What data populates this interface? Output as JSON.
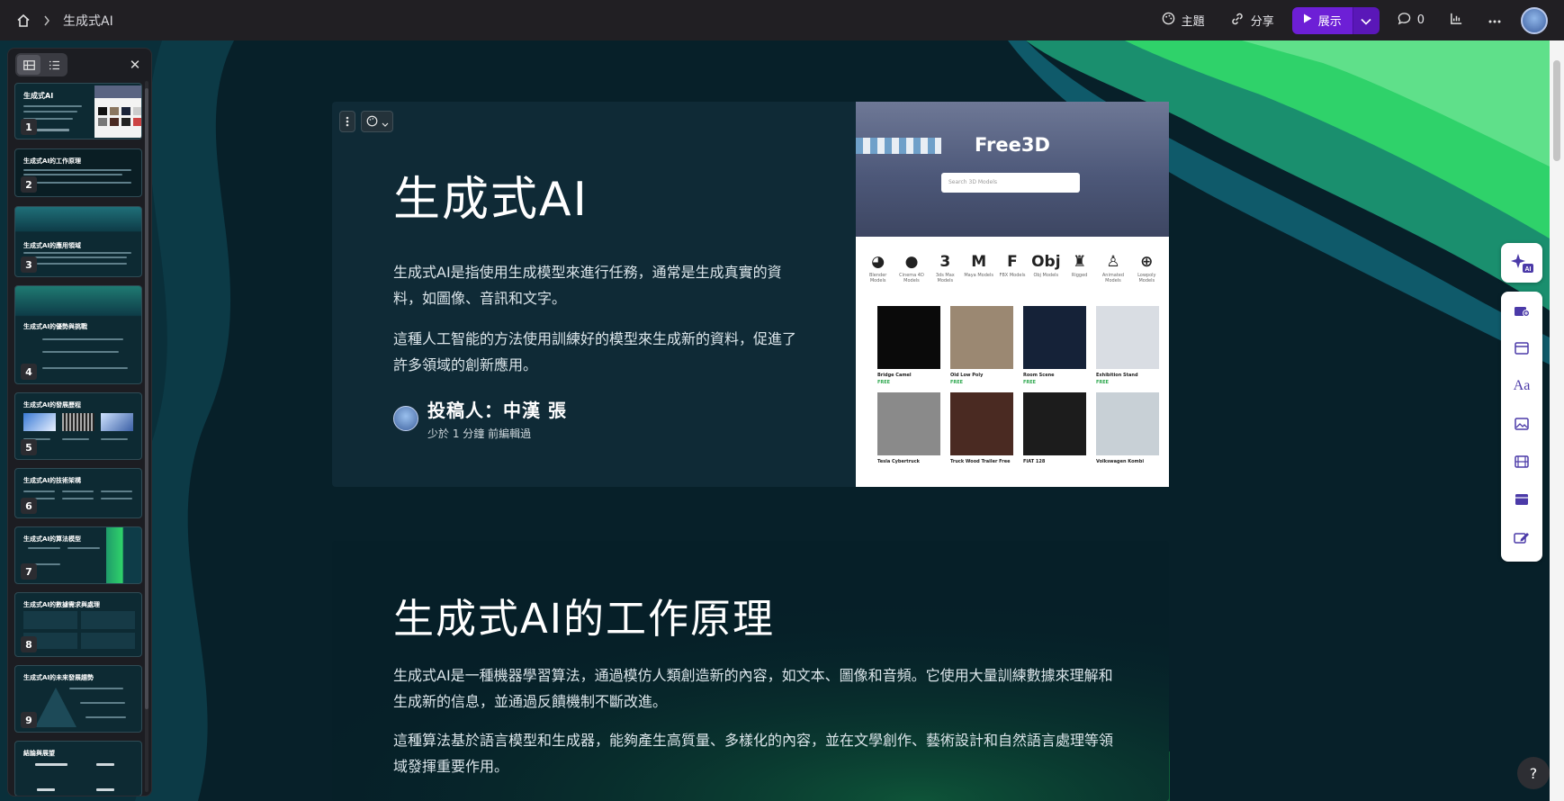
{
  "breadcrumb": {
    "title": "生成式AI"
  },
  "toolbar": {
    "theme_label": "主題",
    "share_label": "分享",
    "present_label": "展示",
    "comment_count": "0"
  },
  "sidebar": {
    "thumbnails": [
      {
        "num": "1",
        "title": "生成式AI"
      },
      {
        "num": "2",
        "title": "生成式AI的工作原理"
      },
      {
        "num": "3",
        "title": "生成式AI的應用領域"
      },
      {
        "num": "4",
        "title": "生成式AI的優勢與挑戰"
      },
      {
        "num": "5",
        "title": "生成式AI的發展歷程"
      },
      {
        "num": "6",
        "title": "生成式AI的技術架構"
      },
      {
        "num": "7",
        "title": "生成式AI的算法模型"
      },
      {
        "num": "8",
        "title": "生成式AI的數據需求與處理"
      },
      {
        "num": "9",
        "title": "生成式AI的未來發展趨勢"
      },
      {
        "num": "",
        "title": "結論與展望"
      }
    ]
  },
  "slide1": {
    "title": "生成式AI",
    "para1": "生成式AI是指使用生成模型來進行任務，通常是生成真實的資料，如圖像、音訊和文字。",
    "para2": "這種人工智能的方法使用訓練好的模型來生成新的資料，促進了許多領域的創新應用。",
    "author": "投稿人：中漢 張",
    "edited": "少於 1 分鐘 前編輯過"
  },
  "free3d": {
    "brand": "Free3D",
    "search_placeholder": "Search 3D Models",
    "categories": [
      {
        "glyph": "◕",
        "label": "Blender Models"
      },
      {
        "glyph": "●",
        "label": "Cinema 4D Models"
      },
      {
        "glyph": "3",
        "label": "3ds Max Models"
      },
      {
        "glyph": "M",
        "label": "Maya Models"
      },
      {
        "glyph": "F",
        "label": "FBX Models"
      },
      {
        "glyph": "Obj",
        "label": "Obj Models"
      },
      {
        "glyph": "♜",
        "label": "Rigged"
      },
      {
        "glyph": "♙",
        "label": "Animated Models"
      },
      {
        "glyph": "⊕",
        "label": "Lowpoly Models"
      }
    ],
    "cards": [
      {
        "name": "Bridge Camel",
        "price": "FREE",
        "color": "#0a0a0a"
      },
      {
        "name": "Old Low Poly",
        "price": "FREE",
        "color": "#9b8872"
      },
      {
        "name": "Room Scene",
        "price": "FREE",
        "color": "#152238"
      },
      {
        "name": "Exhibition Stand",
        "price": "FREE",
        "color": "#d9dde3"
      },
      {
        "name": "Tesla Cybertruck",
        "price": "",
        "color": "#8a8a8a"
      },
      {
        "name": "Truck Wood Trailer Free",
        "price": "",
        "color": "#4a2a22"
      },
      {
        "name": "FIAT 128",
        "price": "",
        "color": "#1c1c1c"
      },
      {
        "name": "Volkswagen Kombi",
        "price": "",
        "color": "#c8d0d6"
      }
    ]
  },
  "slide2": {
    "title": "生成式AI的工作原理",
    "para1": "生成式AI是一種機器學習算法，通過模仿人類創造新的內容，如文本、圖像和音頻。它使用大量訓練數據來理解和生成新的信息，並通過反饋機制不斷改進。",
    "para2": "這種算法基於語言模型和生成器，能夠產生高質量、多樣化的內容，並在文學創作、藝術設計和自然語言處理等領域發揮重要作用。"
  },
  "help": {
    "label": "?"
  },
  "colors": {
    "accent": "#6d1fd6",
    "wave_green": "#2fd26a",
    "wave_teal": "#0f5a6a",
    "slide_bg": "#0f2a36"
  }
}
